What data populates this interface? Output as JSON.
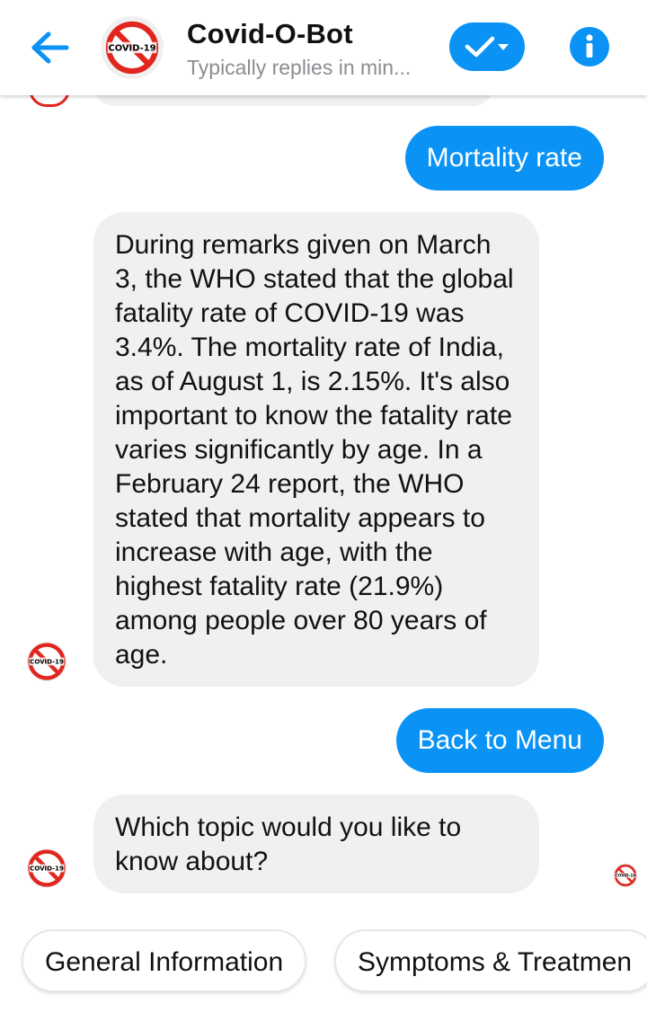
{
  "header": {
    "title": "Covid-O-Bot",
    "subtitle": "Typically replies in min...",
    "avatar_text": "COVID-19"
  },
  "messages": {
    "user_1": "Mortality rate",
    "bot_1": "During remarks given on March 3, the WHO stated that the global fatality rate of COVID-19 was 3.4%. The mortality rate of India, as of August 1, is 2.15%. It's also important to know the fatality rate varies significantly by age. In a February 24 report, the WHO stated that mortality appears to increase with age, with the highest fatality rate (21.9%) among people over 80 years of age.",
    "user_2": "Back to Menu",
    "bot_2": "Which topic would you like to know about?"
  },
  "quick_replies": [
    "General Information",
    "Symptoms & Treatmen"
  ],
  "colors": {
    "accent": "#0a93f5",
    "bot_bubble": "#f1f0f0",
    "logo_red": "#e0261e"
  },
  "icons": {
    "back": "arrow-left-icon",
    "check": "check-dropdown-icon",
    "info": "info-icon",
    "logo": "no-covid-logo"
  }
}
